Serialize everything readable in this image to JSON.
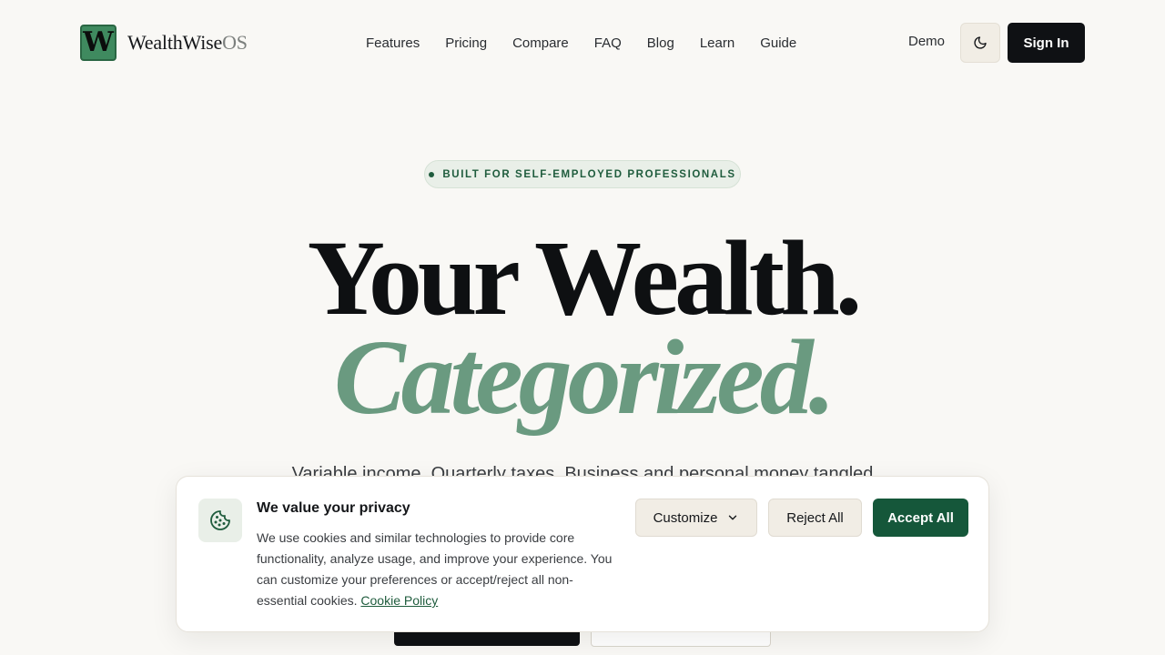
{
  "brand": {
    "mark": "W",
    "name": "WealthWise",
    "suffix": "OS"
  },
  "nav": {
    "items": [
      "Features",
      "Pricing",
      "Compare",
      "FAQ",
      "Blog",
      "Learn",
      "Guide"
    ],
    "demo_label": "Demo",
    "theme_icon": "moon-icon",
    "signin_label": "Sign In"
  },
  "hero": {
    "badge": "BUILT FOR SELF-EMPLOYED PROFESSIONALS",
    "line1": "Your Wealth.",
    "line2": "Categorized.",
    "subtitle": "Variable income. Quarterly taxes. Business and personal money tangled"
  },
  "cookie_banner": {
    "icon": "cookie-icon",
    "title": "We value your privacy",
    "body": "We use cookies and similar technologies to provide core functionality, analyze usage, and improve your experience. You can customize your preferences or accept/reject all non-essential cookies.",
    "policy_link": "Cookie Policy",
    "customize_label": "Customize",
    "reject_label": "Reject All",
    "accept_label": "Accept All"
  },
  "colors": {
    "background": "#f9f8f5",
    "brand_green": "#15573a",
    "accent_sage": "#6a9a80",
    "ink": "#0f1114"
  }
}
